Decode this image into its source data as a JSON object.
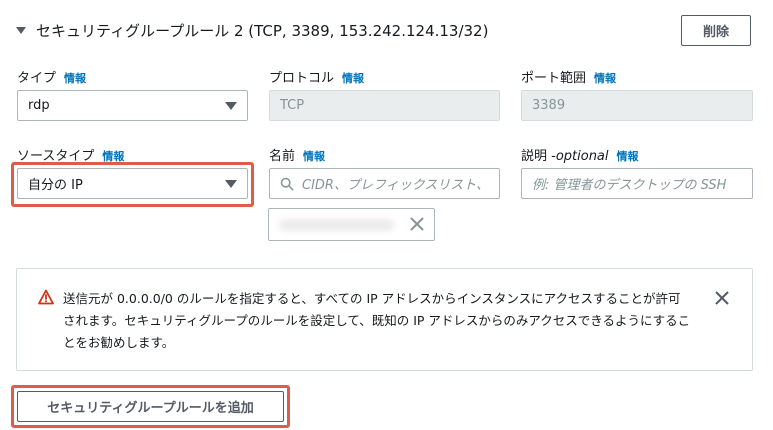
{
  "rule": {
    "title": "セキュリティグループルール 2 (TCP, 3389, 153.242.124.13/32)",
    "delete_label": "削除"
  },
  "info_label": "情報",
  "type": {
    "label": "タイプ",
    "value": "rdp"
  },
  "protocol": {
    "label": "プロトコル",
    "value": "TCP"
  },
  "port_range": {
    "label": "ポート範囲",
    "value": "3389"
  },
  "source_type": {
    "label": "ソースタイプ",
    "value": "自分の IP"
  },
  "name": {
    "label": "名前",
    "placeholder": "CIDR、プレフィックスリスト、"
  },
  "description": {
    "label": "説明 - ",
    "optional": "optional",
    "placeholder": "例: 管理者のデスクトップの SSH"
  },
  "alert": {
    "text": "送信元が 0.0.0.0/0 のルールを指定すると、すべての IP アドレスからインスタンスにアクセスすることが許可されます。セキュリティグループのルールを設定して、既知の IP アドレスからのみアクセスできるようにすることをお勧めします。"
  },
  "add_rule_label": "セキュリティグループルールを追加",
  "colors": {
    "link": "#0073bb",
    "highlight": "#e05a4e",
    "warning": "#d13212"
  }
}
